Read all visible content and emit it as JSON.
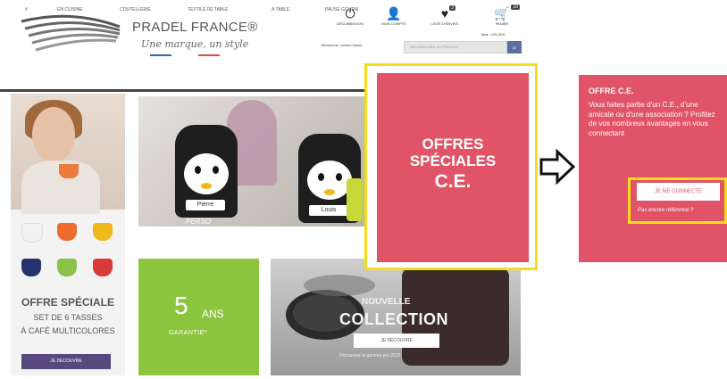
{
  "colors": {
    "accent_pink": "#e15467",
    "highlight_yellow": "#f3de1b",
    "button_purple": "#574880",
    "green": "#8cc63f"
  },
  "header": {
    "brand_title": "PRADEL FRANCE®",
    "brand_tagline": "Une marque, un style",
    "greeting": "Bienvenue, cuisine Name",
    "search_placeholder": "RECHERCHER UN PRODUIT",
    "total": "Total : 125.00 €",
    "icons": [
      {
        "label": "DÉCONNEXION",
        "icon": "power-icon"
      },
      {
        "label": "MON COMPTE",
        "icon": "user-icon"
      },
      {
        "label": "LISTE D'ENVIES",
        "icon": "heart-icon",
        "badge": "3"
      },
      {
        "label": "PANIER",
        "icon": "cart-icon",
        "badge": "10"
      }
    ]
  },
  "nav": {
    "items": [
      "#",
      "EN CUISINE",
      "COUTELLERIE",
      "TEXTILE DE TABLE",
      "À TABLE",
      "PAUSE GOURM"
    ]
  },
  "promo_left": {
    "title": "OFFRE SPÉCIALE",
    "line1": "SET DE 6 TASSES",
    "line2": "À CAFÉ MULTICOLORES",
    "button": "JE DÉCOUVRE"
  },
  "lunch_bags": {
    "tag1": "Pierre",
    "tag2": "Louis",
    "signature": "PERSO"
  },
  "guarantee": {
    "big": "5",
    "ans": "ANS",
    "label": "GARANTIE*"
  },
  "collection": {
    "kicker": "NOUVELLE",
    "title": "COLLECTION",
    "button": "JE DÉCOUVRE",
    "subtitle": "Découvrez la gamme pro 2015"
  },
  "ce_offer": {
    "line1": "OFFRES",
    "line2": "SPÉCIALES",
    "line3": "C.E."
  },
  "panel": {
    "title": "OFFRE C.E.",
    "text": "Vous faites partie d'un C.E., d'une amicale ou d'une association ? Profitez de vos nombreux avantages en vous connectant",
    "button": "JE ME CONNECTE",
    "link": "Pas encore référencé ?"
  }
}
